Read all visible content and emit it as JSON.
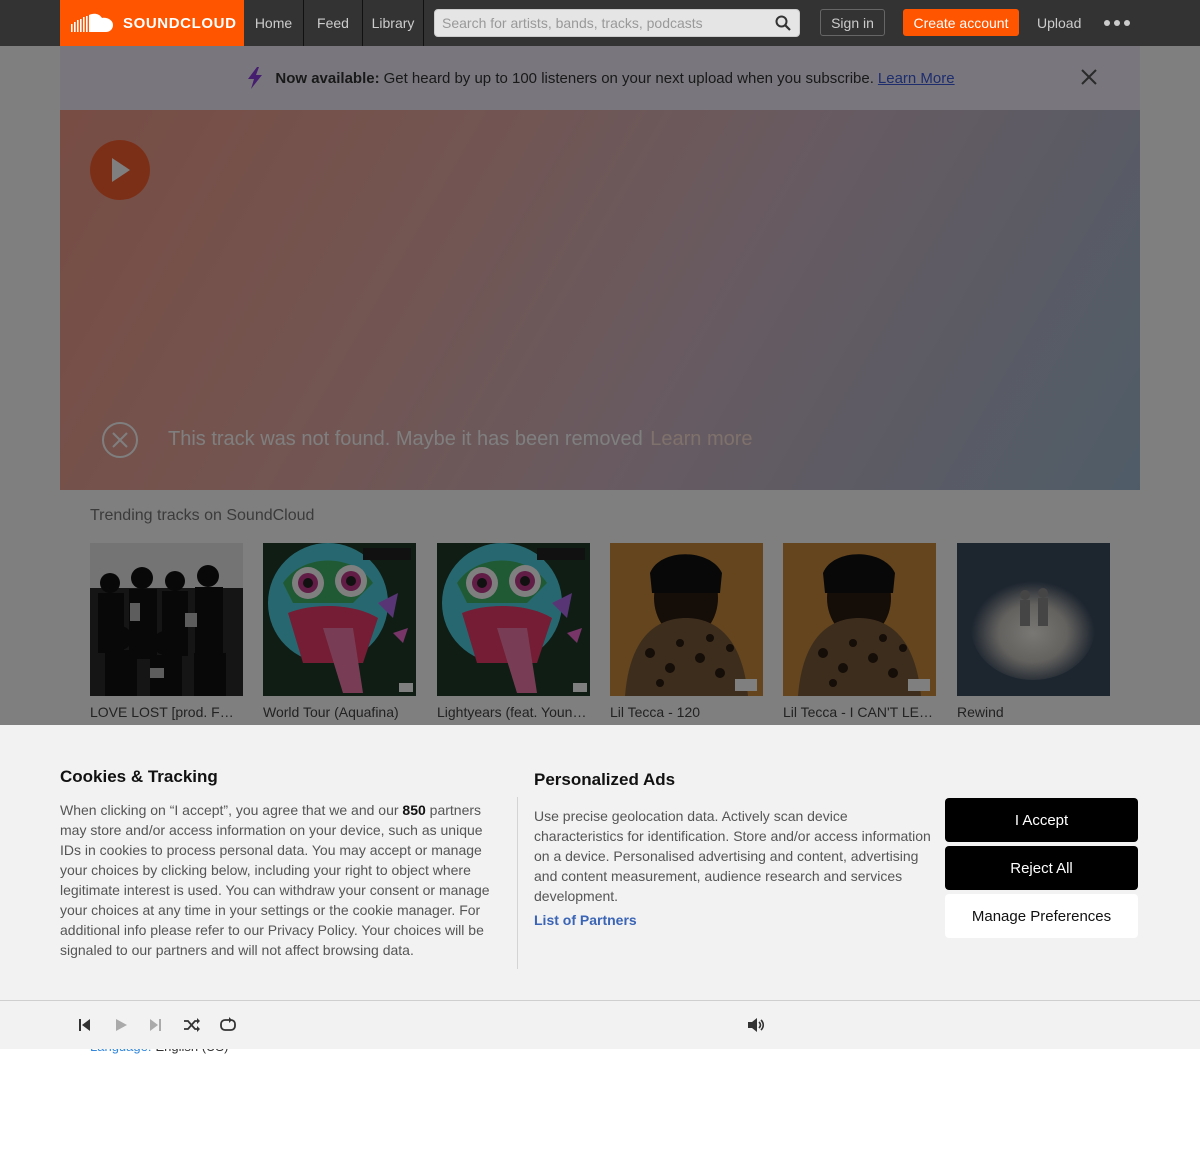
{
  "header": {
    "brand": "SOUNDCLOUD",
    "nav": [
      "Home",
      "Feed",
      "Library"
    ],
    "search_placeholder": "Search for artists, bands, tracks, podcasts",
    "signin": "Sign in",
    "create_account": "Create account",
    "upload": "Upload",
    "colors": {
      "brand": "#ff5500",
      "bar": "#333333"
    }
  },
  "banner": {
    "bold": "Now available:",
    "text": "Get heard by up to 100 listeners on your next upload when you subscribe.",
    "link": "Learn More"
  },
  "hero": {
    "error": "This track was not found. Maybe it has been removed",
    "learn_more": "Learn more"
  },
  "trending": {
    "title": "Trending tracks on SoundCloud",
    "tracks": [
      {
        "title": "LOVE LOST [prod. FCK...",
        "art": "group-photo-bw"
      },
      {
        "title": "World Tour (Aquafina)",
        "art": "cartoon-planet"
      },
      {
        "title": "Lightyears (feat. Young ...",
        "art": "cartoon-planet"
      },
      {
        "title": "Lil Tecca - 120",
        "art": "leopard-portrait"
      },
      {
        "title": "Lil Tecca - I CAN'T LET ...",
        "art": "leopard-portrait"
      },
      {
        "title": "Rewind",
        "art": "spotlight-duo"
      }
    ]
  },
  "footer": {
    "language_label": "Language:",
    "language_value": "English (US)"
  },
  "cookie": {
    "title": "Cookies & Tracking",
    "body_before": "When clicking on “I accept”, you agree that we and our",
    "partner_count": "850",
    "body_after": "partners may store and/or access information on your device, such as unique IDs in cookies to process personal data. You may accept or manage your choices by clicking below, including your right to object where legitimate interest is used. You can withdraw your consent or manage your choices at any time in your settings or the cookie manager. For additional info please refer to our Privacy Policy. Your choices will be signaled to our partners and will not affect browsing data.",
    "ads_title": "Personalized Ads",
    "ads_body": "Use precise geolocation data. Actively scan device characteristics for identification. Store and/or access information on a device. Personalised advertising and content, advertising and content measurement, audience research and services development.",
    "partners_link": "List of Partners",
    "accept": "I Accept",
    "reject": "Reject All",
    "manage": "Manage Preferences"
  },
  "player": {
    "controls": [
      "skip-back-icon",
      "play-icon",
      "skip-forward-icon",
      "shuffle-icon",
      "repeat-icon",
      "volume-icon"
    ]
  }
}
